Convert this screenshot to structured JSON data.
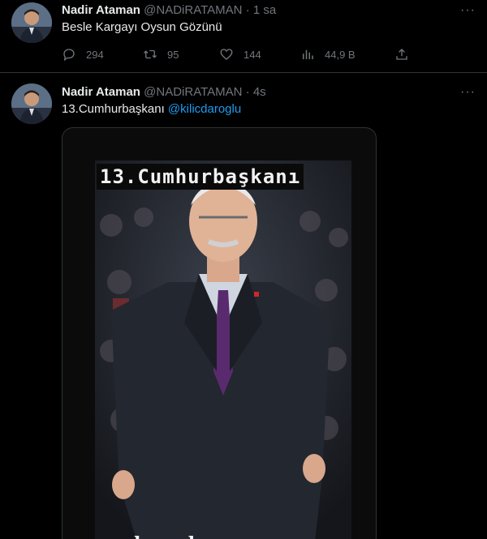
{
  "tweets": [
    {
      "author_name": "Nadir Ataman",
      "handle": "@NADiRATAMAN",
      "separator": "·",
      "time": "1 sa",
      "text": "Besle Kargayı Oysun Gözünü",
      "metrics": {
        "replies": "294",
        "retweets": "95",
        "likes": "144",
        "views": "44,9 B"
      }
    },
    {
      "author_name": "Nadir Ataman",
      "handle": "@NADiRATAMAN",
      "separator": "·",
      "time": "4s",
      "text": "13.Cumhurbaşkanı",
      "mention": "@kilicdaroglu",
      "media": {
        "title": "13.Cumhurbaşkanı",
        "signature": "kemal"
      }
    }
  ],
  "more_label": "···",
  "icons": [
    "reply-icon",
    "retweet-icon",
    "like-icon",
    "views-icon",
    "share-icon",
    "more-icon"
  ],
  "colors": {
    "background": "#000000",
    "text": "#e7e9ea",
    "muted": "#71767b",
    "link": "#1d9bf0",
    "divider": "#2f3336"
  }
}
